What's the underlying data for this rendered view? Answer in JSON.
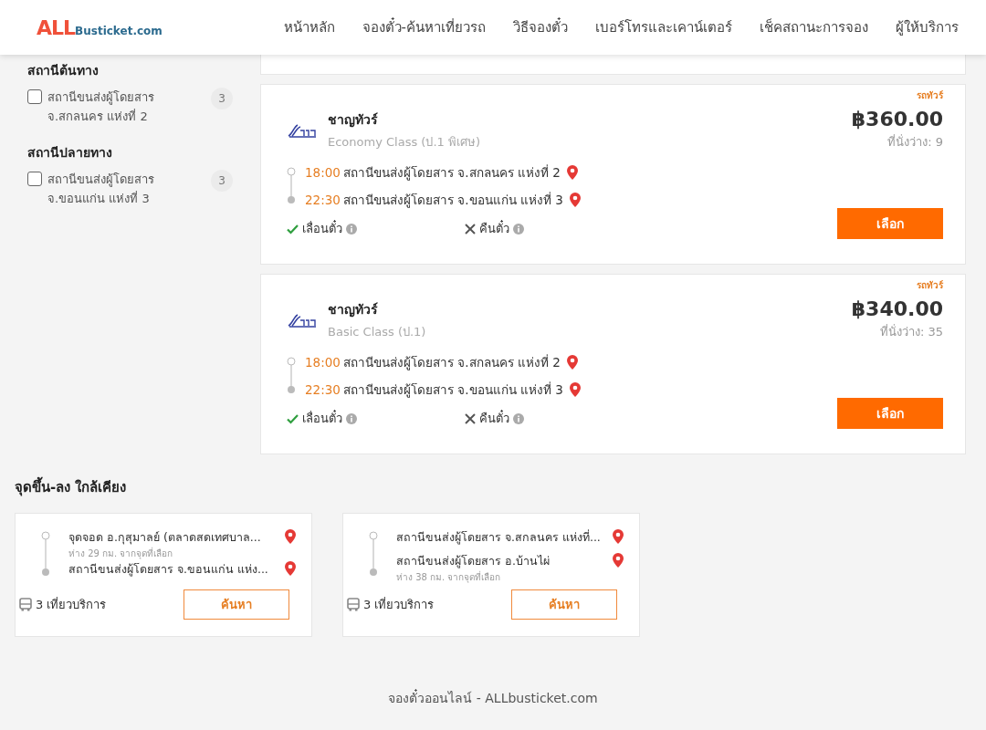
{
  "header": {
    "logo": {
      "brand": "ALL",
      "suffix": "Busticket.com"
    },
    "nav": [
      "หน้าหลัก",
      "จองตั๋ว-ค้นหาเที่ยวรถ",
      "วิธีจองตั๋ว",
      "เบอร์โทรและเคาน์เตอร์",
      "เช็คสถานะการจอง",
      "ผู้ให้บริการ"
    ]
  },
  "sidebar": {
    "groups": [
      {
        "title": "สถานีต้นทาง",
        "items": [
          {
            "label": "สถานีขนส่งผู้โดยสาร จ.สกลนคร แห่งที่ 2",
            "count": "3",
            "checked": false
          }
        ]
      },
      {
        "title": "สถานีปลายทาง",
        "items": [
          {
            "label": "สถานีขนส่งผู้โดยสาร จ.ขอนแก่น แห่งที่ 3",
            "count": "3",
            "checked": false
          }
        ]
      }
    ]
  },
  "trips": [
    {
      "tag": "รถทัวร์",
      "operator": "ชาญทัวร์",
      "bus_class": "Economy Class (ป.1 พิเศษ)",
      "price": "฿360.00",
      "seats": "ที่นั่งว่าง: 9",
      "stops": [
        {
          "time": "18:00",
          "station": "สถานีขนส่งผู้โดยสาร จ.สกลนคร แห่งที่ 2"
        },
        {
          "time": "22:30",
          "station": "สถานีขนส่งผู้โดยสาร จ.ขอนแก่น แห่งที่ 3"
        }
      ],
      "policies": [
        {
          "label": "เลื่อนตั๋ว",
          "allowed": true
        },
        {
          "label": "คืนตั๋ว",
          "allowed": false
        }
      ],
      "button": "เลือก"
    },
    {
      "tag": "รถทัวร์",
      "operator": "ชาญทัวร์",
      "bus_class": "Basic Class (ป.1)",
      "price": "฿340.00",
      "seats": "ที่นั่งว่าง: 35",
      "stops": [
        {
          "time": "18:00",
          "station": "สถานีขนส่งผู้โดยสาร จ.สกลนคร แห่งที่ 2"
        },
        {
          "time": "22:30",
          "station": "สถานีขนส่งผู้โดยสาร จ.ขอนแก่น แห่งที่ 3"
        }
      ],
      "policies": [
        {
          "label": "เลื่อนตั๋ว",
          "allowed": true
        },
        {
          "label": "คืนตั๋ว",
          "allowed": false
        }
      ],
      "button": "เลือก"
    }
  ],
  "nearby": {
    "title": "จุดขึ้น-ลง ใกล้เคียง",
    "cards": [
      {
        "stops": [
          {
            "name": "จุดจอด อ.กุสุมาลย์ (ตลาดสดเทศบาล...",
            "distance": "ห่าง 29 กม. จากจุดที่เลือก"
          },
          {
            "name": "สถานีขนส่งผู้โดยสาร จ.ขอนแก่น แห่ง..."
          }
        ],
        "trips": "3 เที่ยวบริการ",
        "button": "ค้นหา"
      },
      {
        "stops": [
          {
            "name": "สถานีขนส่งผู้โดยสาร จ.สกลนคร แห่งที่..."
          },
          {
            "name": "สถานีขนส่งผู้โดยสาร อ.บ้านไผ่",
            "distance": "ห่าง 38 กม. จากจุดที่เลือก"
          }
        ],
        "trips": "3 เที่ยวบริการ",
        "button": "ค้นหา"
      }
    ]
  },
  "footer": "จองตั๋วออนไลน์ - ALLbusticket.com"
}
